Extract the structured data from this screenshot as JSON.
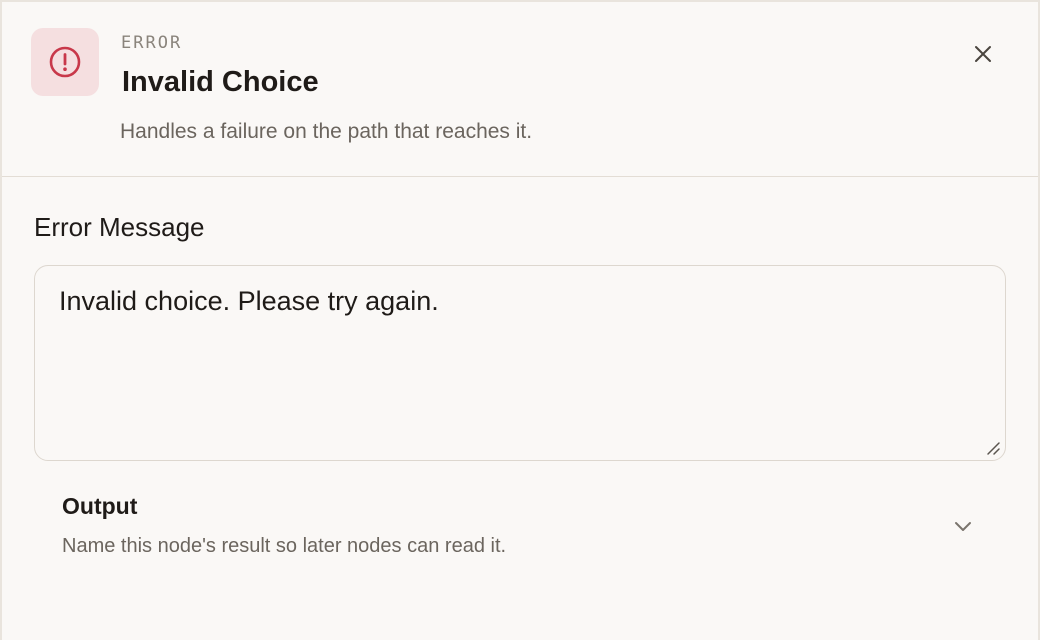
{
  "header": {
    "eyebrow": "ERROR",
    "title": "Invalid Choice",
    "subtitle": "Handles a failure on the path that reaches it.",
    "icon": "alert-circle-icon",
    "accent_color": "#c8384a",
    "icon_tile_color": "#f5dfe0"
  },
  "error_message": {
    "label": "Error Message",
    "value": "Invalid choice. Please try again."
  },
  "output": {
    "title": "Output",
    "description": "Name this node's result so later nodes can read it."
  }
}
